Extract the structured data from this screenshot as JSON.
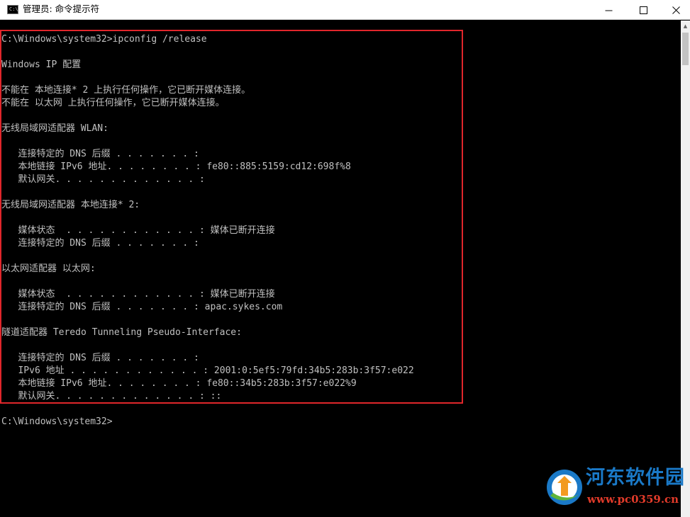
{
  "window": {
    "title": "管理员: 命令提示符",
    "icon": "cmd-icon",
    "icon_text": "C:\\",
    "minimize_label": "—",
    "maximize_label": "☐",
    "close_label": "✕"
  },
  "console": {
    "lines": [
      "C:\\Windows\\system32>ipconfig /release",
      "",
      "Windows IP 配置",
      "",
      "不能在 本地连接* 2 上执行任何操作，它已断开媒体连接。",
      "不能在 以太网 上执行任何操作，它已断开媒体连接。",
      "",
      "无线局域网适配器 WLAN:",
      "",
      "   连接特定的 DNS 后缀 . . . . . . . :",
      "   本地链接 IPv6 地址. . . . . . . . : fe80::885:5159:cd12:698f%8",
      "   默认网关. . . . . . . . . . . . . :",
      "",
      "无线局域网适配器 本地连接* 2:",
      "",
      "   媒体状态  . . . . . . . . . . . . : 媒体已断开连接",
      "   连接特定的 DNS 后缀 . . . . . . . :",
      "",
      "以太网适配器 以太网:",
      "",
      "   媒体状态  . . . . . . . . . . . . : 媒体已断开连接",
      "   连接特定的 DNS 后缀 . . . . . . . : apac.sykes.com",
      "",
      "隧道适配器 Teredo Tunneling Pseudo-Interface:",
      "",
      "   连接特定的 DNS 后缀 . . . . . . . :",
      "   IPv6 地址 . . . . . . . . . . . . : 2001:0:5ef5:79fd:34b5:283b:3f57:e022",
      "   本地链接 IPv6 地址. . . . . . . . : fe80::34b5:283b:3f57:e022%9",
      "   默认网关. . . . . . . . . . . . . : ::",
      "",
      "C:\\Windows\\system32>"
    ],
    "text_color": "#c0c0c0",
    "background": "#000000"
  },
  "annotation": {
    "highlight_color": "#e0262b"
  },
  "watermark": {
    "name": "河东软件园",
    "url": "www.pc0359.cn",
    "name_color": "#1a79c7",
    "url_color": "#e23b2a"
  }
}
